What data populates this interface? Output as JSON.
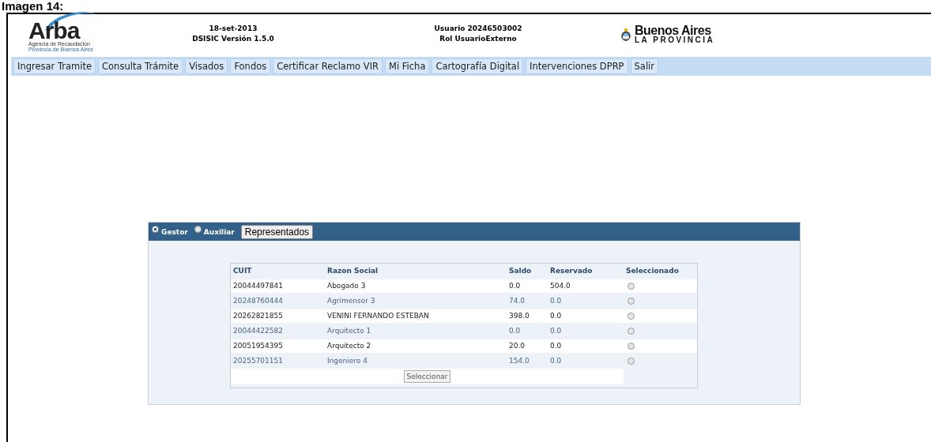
{
  "caption": "Imagen 14:",
  "header": {
    "logo": {
      "name": "Arba",
      "subtitle_1": "Agencia de Recaudación",
      "subtitle_2": "Provincia de Buenos Aires"
    },
    "date": "18-set-2013",
    "version": "DSISIC Versión 1.5.0",
    "user": "Usuario 20246503002",
    "role": "Rol UsuarioExterno",
    "province_logo": {
      "line_1": "Buenos Aires",
      "line_2": "LA PROVINCIA"
    }
  },
  "menu": [
    "Ingresar Tramite",
    "Consulta Trámite",
    "Visados",
    "Fondos",
    "Certificar Reclamo VIR",
    "Mi Ficha",
    "Cartografía Digital",
    "Intervenciones DPRP",
    "Salir"
  ],
  "panel": {
    "modes": [
      {
        "label": "Gestor",
        "selected": true
      },
      {
        "label": "Auxiliar",
        "selected": false
      }
    ],
    "button": "Representados",
    "table": {
      "columns": [
        "CUIT",
        "Razon Social",
        "Saldo",
        "Reservado",
        "Seleccionado"
      ],
      "rows": [
        {
          "cuit": "20044497841",
          "razon_social": "Abogado 3",
          "saldo": "0.0",
          "reservado": "504.0",
          "selected": false
        },
        {
          "cuit": "20248760444",
          "razon_social": "Agrimensor 3",
          "saldo": "74.0",
          "reservado": "0.0",
          "selected": false
        },
        {
          "cuit": "20262821855",
          "razon_social": "VENINI FERNANDO ESTEBAN",
          "saldo": "398.0",
          "reservado": "0.0",
          "selected": false
        },
        {
          "cuit": "20044422582",
          "razon_social": "Arquitecto 1",
          "saldo": "0.0",
          "reservado": "0.0",
          "selected": false
        },
        {
          "cuit": "20051954395",
          "razon_social": "Arquitecto 2",
          "saldo": "20.0",
          "reservado": "0.0",
          "selected": false
        },
        {
          "cuit": "20255701151",
          "razon_social": "Ingeniero 4",
          "saldo": "154.0",
          "reservado": "0.0",
          "selected": false
        }
      ],
      "submit": "Seleccionar"
    }
  }
}
